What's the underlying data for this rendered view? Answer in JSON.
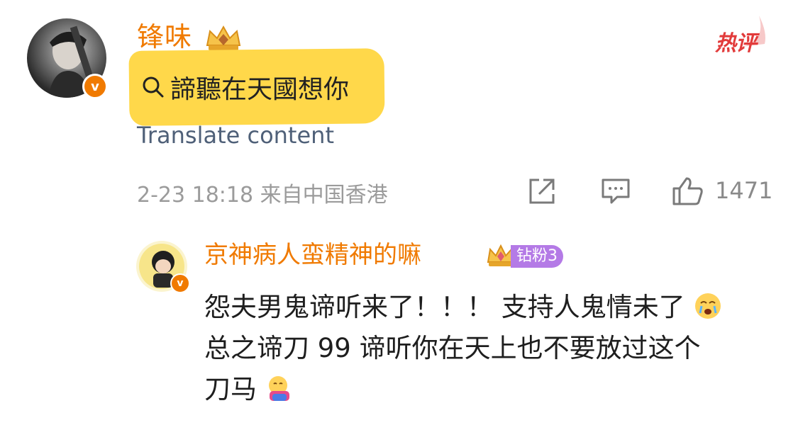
{
  "comment": {
    "username": "锋味",
    "hot_label": "热评",
    "search_link_text": "諦聽在天國想你",
    "translate_label": "Translate content",
    "meta": "2-23 18:18 来自中国香港",
    "like_count": "1471",
    "icons": [
      "share-icon",
      "comment-icon",
      "like-icon",
      "search-icon",
      "crown-icon"
    ]
  },
  "reply": {
    "username": "京神病人蛮精神的嘛",
    "fan_badge": "钻粉3",
    "text_line1": "怨夫男鬼谛听来了！！！ 支持人鬼情未了",
    "text_line2": "总之谛刀 99 谛听你在天上也不要放过这个",
    "text_line3": "刀马",
    "emojis": [
      "crying-face-emoji",
      "hugging-face-emoji"
    ]
  },
  "colors": {
    "username": "#f07a00",
    "highlight": "#ffd84a",
    "translate": "#4f6078",
    "meta": "#9b9b9b",
    "hot": "#e23b3b",
    "fan_badge": "#b47ae6"
  }
}
